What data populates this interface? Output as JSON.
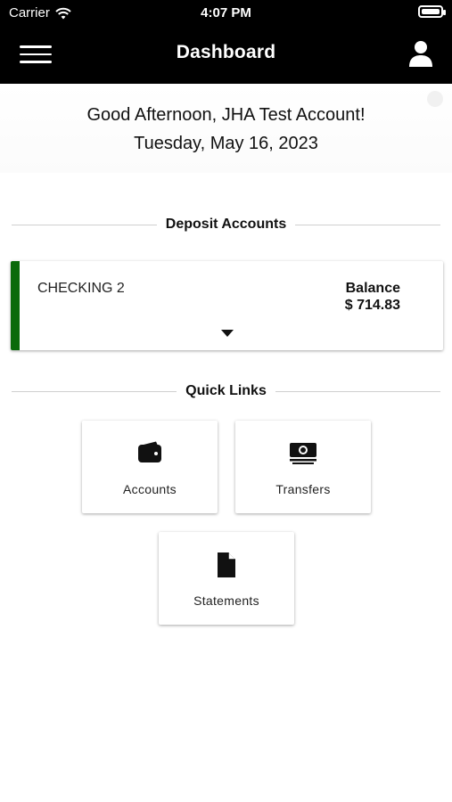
{
  "status_bar": {
    "carrier": "Carrier",
    "time": "4:07 PM"
  },
  "nav": {
    "title": "Dashboard"
  },
  "greeting": {
    "line1": "Good Afternoon, JHA Test Account!",
    "line2": "Tuesday, May 16, 2023"
  },
  "deposit_accounts": {
    "heading": "Deposit Accounts",
    "accounts": [
      {
        "name": "CHECKING 2",
        "balance_label": "Balance",
        "balance": "$ 714.83",
        "accent_color": "#0b6a0b"
      }
    ]
  },
  "quick_links": {
    "heading": "Quick Links",
    "items": [
      {
        "label": "Accounts",
        "icon": "wallet-icon"
      },
      {
        "label": "Transfers",
        "icon": "money-icon"
      },
      {
        "label": "Statements",
        "icon": "document-icon"
      }
    ]
  },
  "colors": {
    "header_bg": "#000000",
    "accent": "#0b6a0b"
  }
}
